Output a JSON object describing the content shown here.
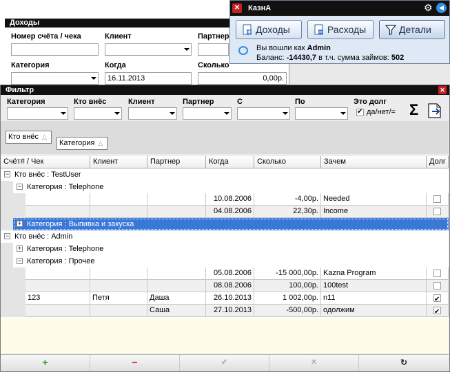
{
  "income_form": {
    "title": "Доходы",
    "account_label": "Номер счёта / чека",
    "client_label": "Клиент",
    "partner_label": "Партнер",
    "category_label": "Категория",
    "when_label": "Когда",
    "when_value": "16.11.2013",
    "amount_label": "Сколько",
    "amount_value": "0,00р."
  },
  "popup": {
    "title": "КазнА",
    "buttons": {
      "income": "Доходы",
      "expenses": "Расходы",
      "details": "Детали"
    },
    "logged_as_prefix": "Вы вошли как",
    "user": "Admin",
    "balance_prefix": "Баланс:",
    "balance_value": "-14430,7",
    "loans_prefix": "в т.ч. сумма займов:",
    "loans_value": "502"
  },
  "filter": {
    "title": "Фильтр",
    "labels": {
      "category": "Категория",
      "who": "Кто внёс",
      "client": "Клиент",
      "partner": "Партнер",
      "from": "С",
      "to": "По",
      "is_debt": "Это долг",
      "debt_option": "да/нет/="
    },
    "sum_symbol": "Σ"
  },
  "group_tags": [
    "Кто внёс",
    "Категория"
  ],
  "grid": {
    "columns": [
      "Счёт# / Чек",
      "Клиент",
      "Партнер",
      "Когда",
      "Сколько",
      "Зачем",
      "Долг"
    ],
    "groups": [
      "Кто внёс : TestUser",
      "Категория : Telephone",
      "Категория : Выпивка и закуска",
      "Кто внёс : Admin",
      "Категория : Telephone",
      "Категория : Прочее"
    ],
    "rows": [
      {
        "account": "",
        "client": "",
        "partner": "",
        "when": "10.08.2006",
        "amount": "-4,00р.",
        "why": "Needed",
        "debt": false
      },
      {
        "account": "",
        "client": "",
        "partner": "",
        "when": "04.08.2006",
        "amount": "22,30р.",
        "why": "Income",
        "debt": false
      },
      {
        "account": "",
        "client": "",
        "partner": "",
        "when": "05.08.2006",
        "amount": "-15 000,00р.",
        "why": "Kazna Program",
        "debt": false
      },
      {
        "account": "",
        "client": "",
        "partner": "",
        "when": "08.08.2006",
        "amount": "100,00р.",
        "why": "100test",
        "debt": false
      },
      {
        "account": "123",
        "client": "Петя",
        "partner": "Даша",
        "when": "26.10.2013",
        "amount": "1 002,00р.",
        "why": "n11",
        "debt": true
      },
      {
        "account": "",
        "client": "",
        "partner": "Саша",
        "when": "27.10.2013",
        "amount": "-500,00р.",
        "why": "одолжим",
        "debt": true
      }
    ]
  },
  "bottom_bar": {
    "add": "+",
    "remove": "−",
    "confirm": "✔",
    "cancel": "✕",
    "refresh": "↻"
  },
  "colors": {
    "selection": "#3a78d8",
    "title_bar": "#111111",
    "empty_area": "#fffde7",
    "add": "#1e9d2c",
    "remove": "#d01f1f"
  }
}
